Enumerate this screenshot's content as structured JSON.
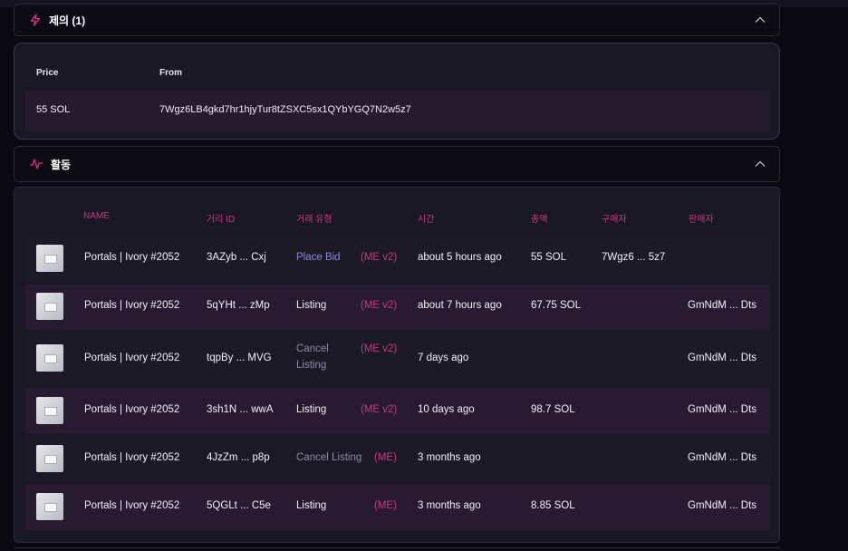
{
  "offers": {
    "title": "제의 (1)",
    "columns": {
      "price": "Price",
      "from": "From"
    },
    "rows": [
      {
        "price": "55 SOL",
        "from": "7Wgz6LB4gkd7hr1hjyTur8tZSXC5sx1QYbYGQ7N2w5z7"
      }
    ]
  },
  "activity": {
    "title": "활동",
    "columns": {
      "name": "NAME",
      "tx_id": "거리 ID",
      "tx_type": "거래 유형",
      "time": "시간",
      "amount": "총액",
      "buyer": "구매자",
      "seller": "판매자"
    },
    "rows": [
      {
        "name": "Portals | Ivory #2052",
        "tx_id": "3AZyb ... Cxj",
        "type": "Place Bid",
        "type_line2": "",
        "source": "(ME v2)",
        "time": "about 5 hours ago",
        "amount": "55 SOL",
        "buyer": "7Wgz6 ... 5z7",
        "seller": ""
      },
      {
        "name": "Portals | Ivory #2052",
        "tx_id": "5qYHt ... zMp",
        "type": "Listing",
        "type_line2": "",
        "source": "(ME v2)",
        "time": "about 7 hours ago",
        "amount": "67.75 SOL",
        "buyer": "",
        "seller": "GmNdM ... Dts"
      },
      {
        "name": "Portals | Ivory #2052",
        "tx_id": "tqpBy ... MVG",
        "type": "Cancel",
        "type_line2": "Listing",
        "source": "(ME v2)",
        "time": "7 days ago",
        "amount": "",
        "buyer": "",
        "seller": "GmNdM ... Dts"
      },
      {
        "name": "Portals | Ivory #2052",
        "tx_id": "3sh1N ... wwA",
        "type": "Listing",
        "type_line2": "",
        "source": "(ME v2)",
        "time": "10 days ago",
        "amount": "98.7 SOL",
        "buyer": "",
        "seller": "GmNdM ... Dts"
      },
      {
        "name": "Portals | Ivory #2052",
        "tx_id": "4JzZm ... p8p",
        "type": "Cancel Listing",
        "type_line2": "",
        "source": "(ME)",
        "time": "3 months ago",
        "amount": "",
        "buyer": "",
        "seller": "GmNdM ... Dts"
      },
      {
        "name": "Portals | Ivory #2052",
        "tx_id": "5QGLt ... C5e",
        "type": "Listing",
        "type_line2": "",
        "source": "(ME)",
        "time": "3 months ago",
        "amount": "8.85 SOL",
        "buyer": "",
        "seller": "GmNdM ... Dts"
      }
    ]
  },
  "colors": {
    "accent": "#e0338a",
    "muted_type": "#8f8aa3",
    "bid_type": "#8c8ad6"
  },
  "icons": {
    "offers": "lightning-icon",
    "activity": "pulse-icon",
    "collapse": "chevron-up-icon"
  }
}
